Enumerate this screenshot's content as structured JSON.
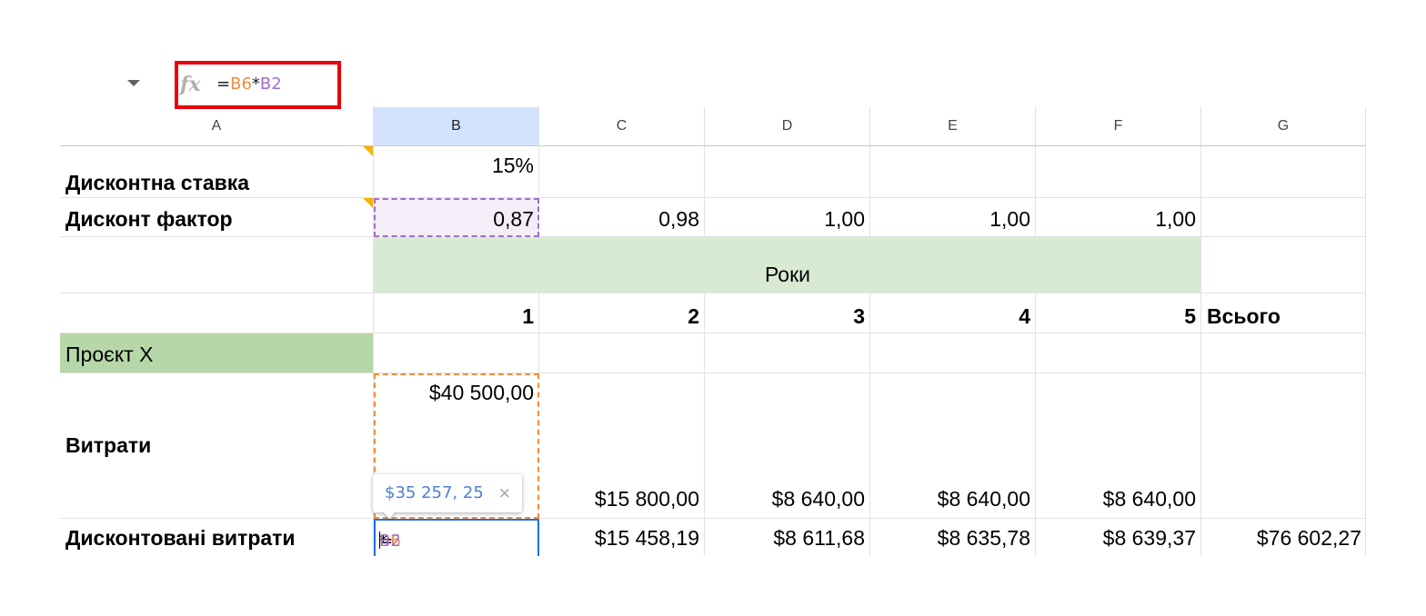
{
  "formula_bar": {
    "fx_label": "fx",
    "formula": {
      "eq": "=",
      "ref1": "B6",
      "op": "*",
      "ref2": "B2"
    }
  },
  "columns": [
    "A",
    "B",
    "C",
    "D",
    "E",
    "F",
    "G"
  ],
  "selected_column": "B",
  "rows": {
    "rate": {
      "label": "Дисконтна ставка",
      "b": "15%"
    },
    "factor": {
      "label": "Дисконт фактор",
      "b": "0,87",
      "c": "0,98",
      "d": "1,00",
      "e": "1,00",
      "f": "1,00"
    },
    "years": {
      "label": "Роки"
    },
    "year_nums": {
      "b": "1",
      "c": "2",
      "d": "3",
      "e": "4",
      "f": "5",
      "g": "Всього"
    },
    "project": {
      "label": "Проєкт X"
    },
    "costs": {
      "label": "Витрати",
      "b": "$40 500,00",
      "c": "$15 800,00",
      "d": "$8 640,00",
      "e": "$8 640,00",
      "f": "$8 640,00"
    },
    "disc_costs": {
      "label": "Дисконтовані витрати",
      "c": "$15 458,19",
      "d": "$8 611,68",
      "e": "$8 635,78",
      "f": "$8 639,37",
      "g": "$76 602,27"
    }
  },
  "tooltip": {
    "value": "$35  257, 25",
    "close": "×"
  },
  "colors": {
    "selected_header": "#d3e3fd",
    "years_fill": "#d9ead3",
    "project_fill": "#b6d7a8",
    "orange_ref": "#f38b3c",
    "purple_ref": "#9d6fce",
    "highlight_box": "#e8000b"
  }
}
